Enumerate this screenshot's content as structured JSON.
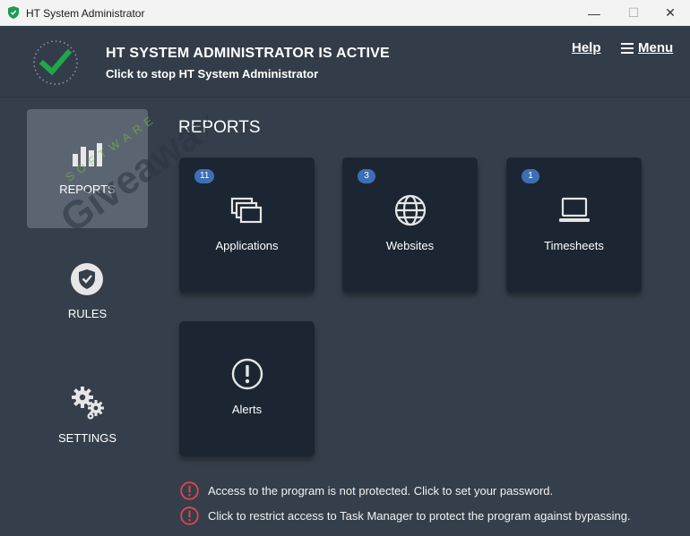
{
  "window": {
    "title": "HT System Administrator",
    "minimize_glyph": "—",
    "maximize_glyph": "☐",
    "close_glyph": "✕"
  },
  "header": {
    "title": "HT SYSTEM ADMINISTRATOR IS ACTIVE",
    "subtitle": "Click to stop HT System Administrator",
    "status_icon": "check-icon",
    "help_label": "Help",
    "menu_label": "Menu"
  },
  "sidebar": {
    "items": [
      {
        "label": "REPORTS",
        "icon": "bar-chart-icon",
        "active": true
      },
      {
        "label": "RULES",
        "icon": "shield-icon",
        "active": false
      },
      {
        "label": "SETTINGS",
        "icon": "gears-icon",
        "active": false
      }
    ]
  },
  "main": {
    "title": "REPORTS",
    "cards": [
      {
        "label": "Applications",
        "badge": "11",
        "icon": "windows-icon"
      },
      {
        "label": "Websites",
        "badge": "3",
        "icon": "globe-icon"
      },
      {
        "label": "Timesheets",
        "badge": "1",
        "icon": "laptop-icon"
      },
      {
        "label": "Alerts",
        "icon": "alert-icon"
      }
    ]
  },
  "notices": [
    {
      "text": "Access to the program is not protected. Click to set your password.",
      "icon": "warning-icon"
    },
    {
      "text": "Click to restrict access to Task Manager to protect the program against bypassing.",
      "icon": "warning-icon"
    }
  ],
  "watermark": {
    "line1": "SOFTWARE",
    "line2": "Giveaway"
  },
  "colors": {
    "background": "#353f4b",
    "card": "#1c2633",
    "active_nav": "#5b6571",
    "badge": "#3d6fb5",
    "success": "#1fa84a",
    "warning": "#e04646"
  }
}
